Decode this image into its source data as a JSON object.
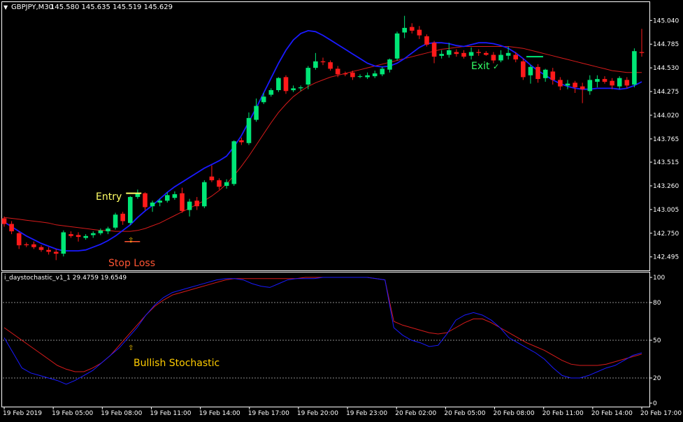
{
  "header": {
    "symbol_label": "GBPJPY,M30",
    "ohlc": "145.580 145.635 145.519 145.629",
    "triangle_glyph": "▼"
  },
  "indicator": {
    "label": "i_daystochastic_v1_1 29.4759 19.6549"
  },
  "annotations": {
    "entry": "Entry",
    "exit": "Exit",
    "exit_check": "✓",
    "stop_loss": "Stop Loss",
    "bullish": "Bullish Stochastic",
    "arrow_glyph": "⇧"
  },
  "colors": {
    "background": "#000000",
    "frame": "#ffffff",
    "bull": "#00e676",
    "bear": "#ff1a1a",
    "ma_fast": "#1a1aff",
    "ma_slow": "#d81b1b",
    "stoch_main": "#1a1aff",
    "stoch_signal": "#d81b1b",
    "entry_text": "#ffff66",
    "exit_text": "#33ff66",
    "stop_text": "#ff5533",
    "bullish_text": "#ffcc00",
    "entry_line": "#ffff66",
    "stop_line": "#ff5533",
    "exit_line": "#00e676"
  },
  "chart_data": [
    {
      "type": "candlestick",
      "series_type": "ohlc",
      "x_ticks": [
        "19 Feb 2019",
        "19 Feb 05:00",
        "19 Feb 08:00",
        "19 Feb 11:00",
        "19 Feb 14:00",
        "19 Feb 17:00",
        "19 Feb 20:00",
        "19 Feb 23:00",
        "20 Feb 02:00",
        "20 Feb 05:00",
        "20 Feb 08:00",
        "20 Feb 11:00",
        "20 Feb 14:00",
        "20 Feb 17:00"
      ],
      "y_ticks": [
        "145.040",
        "144.785",
        "144.530",
        "144.275",
        "144.020",
        "143.765",
        "143.515",
        "143.260",
        "143.005",
        "142.750",
        "142.495"
      ],
      "ylim": [
        142.44,
        145.11
      ],
      "candles": [
        [
          142.91,
          142.93,
          142.82,
          142.85
        ],
        [
          142.85,
          142.88,
          142.74,
          142.77
        ],
        [
          142.75,
          142.77,
          142.58,
          142.62
        ],
        [
          142.63,
          142.65,
          142.6,
          142.62
        ],
        [
          142.63,
          142.66,
          142.58,
          142.6
        ],
        [
          142.6,
          142.62,
          142.55,
          142.57
        ],
        [
          142.57,
          142.6,
          142.52,
          142.55
        ],
        [
          142.55,
          142.58,
          142.46,
          142.53
        ],
        [
          142.53,
          142.78,
          142.5,
          142.76
        ],
        [
          142.74,
          142.77,
          142.7,
          142.72
        ],
        [
          142.73,
          142.76,
          142.66,
          142.71
        ],
        [
          142.7,
          142.74,
          142.68,
          142.72
        ],
        [
          142.73,
          142.77,
          142.7,
          142.75
        ],
        [
          142.75,
          142.8,
          142.73,
          142.78
        ],
        [
          142.77,
          142.82,
          142.74,
          142.8
        ],
        [
          142.81,
          142.97,
          142.79,
          142.95
        ],
        [
          142.96,
          142.98,
          142.84,
          142.88
        ],
        [
          142.86,
          143.15,
          142.84,
          143.14
        ],
        [
          143.14,
          143.22,
          143.12,
          143.18
        ],
        [
          143.18,
          143.19,
          143.0,
          143.03
        ],
        [
          143.04,
          143.1,
          142.98,
          143.08
        ],
        [
          143.08,
          143.12,
          143.04,
          143.1
        ],
        [
          143.1,
          143.19,
          143.08,
          143.16
        ],
        [
          143.13,
          143.2,
          143.11,
          143.17
        ],
        [
          143.18,
          143.24,
          142.97,
          142.99
        ],
        [
          143.0,
          143.12,
          142.93,
          143.09
        ],
        [
          143.1,
          143.14,
          143.0,
          143.04
        ],
        [
          143.04,
          143.32,
          143.02,
          143.3
        ],
        [
          143.36,
          143.48,
          143.3,
          143.32
        ],
        [
          143.32,
          143.34,
          143.22,
          143.25
        ],
        [
          143.26,
          143.33,
          143.23,
          143.3
        ],
        [
          143.28,
          143.75,
          143.26,
          143.74
        ],
        [
          143.75,
          143.78,
          143.7,
          143.73
        ],
        [
          143.72,
          144.05,
          143.7,
          143.99
        ],
        [
          143.97,
          144.2,
          143.95,
          144.12
        ],
        [
          144.16,
          144.26,
          144.14,
          144.22
        ],
        [
          144.24,
          144.31,
          144.22,
          144.29
        ],
        [
          144.29,
          144.43,
          144.27,
          144.42
        ],
        [
          144.43,
          144.45,
          144.25,
          144.28
        ],
        [
          144.29,
          144.34,
          144.27,
          144.31
        ],
        [
          144.31,
          144.34,
          144.28,
          144.32
        ],
        [
          144.35,
          144.55,
          144.3,
          144.53
        ],
        [
          144.53,
          144.69,
          144.51,
          144.6
        ],
        [
          144.6,
          144.64,
          144.56,
          144.59
        ],
        [
          144.59,
          144.61,
          144.5,
          144.52
        ],
        [
          144.52,
          144.55,
          144.43,
          144.46
        ],
        [
          144.47,
          144.49,
          144.44,
          144.46
        ],
        [
          144.48,
          144.5,
          144.4,
          144.43
        ],
        [
          144.44,
          144.46,
          144.42,
          144.44
        ],
        [
          144.43,
          144.48,
          144.41,
          144.45
        ],
        [
          144.44,
          144.5,
          144.42,
          144.47
        ],
        [
          144.46,
          144.54,
          144.44,
          144.52
        ],
        [
          144.51,
          144.63,
          144.48,
          144.62
        ],
        [
          144.63,
          144.92,
          144.61,
          144.9
        ],
        [
          144.91,
          145.09,
          144.85,
          144.96
        ],
        [
          144.97,
          145.01,
          144.9,
          144.93
        ],
        [
          144.94,
          144.98,
          144.84,
          144.88
        ],
        [
          144.87,
          144.89,
          144.76,
          144.78
        ],
        [
          144.8,
          144.82,
          144.58,
          144.65
        ],
        [
          144.66,
          144.72,
          144.63,
          144.68
        ],
        [
          144.67,
          144.8,
          144.64,
          144.72
        ],
        [
          144.7,
          144.73,
          144.65,
          144.68
        ],
        [
          144.69,
          144.72,
          144.63,
          144.65
        ],
        [
          144.66,
          144.75,
          144.62,
          144.7
        ],
        [
          144.7,
          144.73,
          144.66,
          144.69
        ],
        [
          144.69,
          144.71,
          144.66,
          144.67
        ],
        [
          144.67,
          144.7,
          144.58,
          144.61
        ],
        [
          144.61,
          144.72,
          144.59,
          144.67
        ],
        [
          144.66,
          144.76,
          144.62,
          144.69
        ],
        [
          144.67,
          144.7,
          144.59,
          144.62
        ],
        [
          144.6,
          144.63,
          144.4,
          144.43
        ],
        [
          144.45,
          144.56,
          144.36,
          144.54
        ],
        [
          144.54,
          144.57,
          144.37,
          144.41
        ],
        [
          144.42,
          144.52,
          144.38,
          144.51
        ],
        [
          144.49,
          144.53,
          144.35,
          144.4
        ],
        [
          144.4,
          144.43,
          144.29,
          144.33
        ],
        [
          144.34,
          144.4,
          144.3,
          144.36
        ],
        [
          144.37,
          144.39,
          144.26,
          144.32
        ],
        [
          144.33,
          144.37,
          144.15,
          144.3
        ],
        [
          144.28,
          144.45,
          144.24,
          144.4
        ],
        [
          144.38,
          144.45,
          144.32,
          144.41
        ],
        [
          144.41,
          144.44,
          144.36,
          144.38
        ],
        [
          144.39,
          144.42,
          144.3,
          144.34
        ],
        [
          144.33,
          144.44,
          144.3,
          144.42
        ],
        [
          144.4,
          144.43,
          144.31,
          144.34
        ],
        [
          144.35,
          144.74,
          144.32,
          144.71
        ],
        [
          144.7,
          144.95,
          144.65,
          144.69
        ]
      ],
      "ma_fast": [
        142.87,
        142.82,
        142.77,
        142.72,
        142.68,
        142.64,
        142.61,
        142.58,
        142.56,
        142.56,
        142.56,
        142.57,
        142.6,
        142.63,
        142.67,
        142.72,
        142.78,
        142.84,
        142.92,
        142.99,
        143.05,
        143.12,
        143.19,
        143.25,
        143.3,
        143.35,
        143.4,
        143.45,
        143.49,
        143.53,
        143.58,
        143.68,
        143.8,
        143.95,
        144.1,
        144.26,
        144.42,
        144.58,
        144.72,
        144.83,
        144.9,
        144.93,
        144.92,
        144.88,
        144.83,
        144.78,
        144.73,
        144.68,
        144.63,
        144.58,
        144.55,
        144.54,
        144.55,
        144.58,
        144.63,
        144.69,
        144.75,
        144.79,
        144.8,
        144.8,
        144.79,
        144.77,
        144.76,
        144.78,
        144.8,
        144.8,
        144.79,
        144.77,
        144.74,
        144.69,
        144.63,
        144.56,
        144.5,
        144.45,
        144.4,
        144.36,
        144.33,
        144.31,
        144.3,
        144.3,
        144.31,
        144.31,
        144.31,
        144.3,
        144.31,
        144.34,
        144.38
      ],
      "ma_slow": [
        142.92,
        142.91,
        142.9,
        142.89,
        142.88,
        142.87,
        142.86,
        142.84,
        142.83,
        142.82,
        142.81,
        142.8,
        142.79,
        142.78,
        142.78,
        142.77,
        142.77,
        142.77,
        142.78,
        142.8,
        142.83,
        142.86,
        142.9,
        142.94,
        142.98,
        143.02,
        143.06,
        143.1,
        143.15,
        143.21,
        143.28,
        143.37,
        143.47,
        143.58,
        143.7,
        143.82,
        143.94,
        144.05,
        144.14,
        144.22,
        144.28,
        144.33,
        144.37,
        144.4,
        144.43,
        144.45,
        144.47,
        144.49,
        144.51,
        144.53,
        144.55,
        144.57,
        144.59,
        144.61,
        144.63,
        144.65,
        144.67,
        144.69,
        144.71,
        144.73,
        144.74,
        144.75,
        144.76,
        144.76,
        144.76,
        144.76,
        144.76,
        144.76,
        144.76,
        144.75,
        144.74,
        144.72,
        144.7,
        144.68,
        144.66,
        144.64,
        144.62,
        144.6,
        144.58,
        144.56,
        144.54,
        144.52,
        144.5,
        144.49,
        144.48,
        144.48,
        144.48
      ],
      "entry_price": 143.18,
      "stop_price": 142.66,
      "exit_price": 144.65,
      "entry_index": 17,
      "exit_index": 71
    },
    {
      "type": "line",
      "ylim": [
        0,
        100
      ],
      "y_ticks": [
        0,
        20,
        50,
        80,
        100
      ],
      "levels": [
        20,
        50,
        80
      ],
      "stoch_main": [
        52,
        40,
        28,
        24,
        22,
        20,
        18,
        15,
        18,
        22,
        26,
        32,
        38,
        44,
        52,
        60,
        70,
        78,
        84,
        88,
        90,
        92,
        94,
        96,
        98,
        99,
        99,
        98,
        95,
        93,
        92,
        95,
        98,
        99,
        99,
        99,
        100,
        100,
        100,
        100,
        100,
        100,
        99,
        98,
        60,
        54,
        50,
        48,
        45,
        46,
        55,
        66,
        70,
        72,
        70,
        66,
        60,
        52,
        48,
        44,
        40,
        35,
        28,
        22,
        20,
        20,
        22,
        25,
        28,
        30,
        34,
        38,
        40
      ],
      "stoch_signal": [
        60,
        55,
        50,
        45,
        40,
        35,
        30,
        27,
        25,
        25,
        28,
        32,
        38,
        46,
        54,
        62,
        70,
        77,
        82,
        86,
        88,
        90,
        92,
        94,
        96,
        98,
        99,
        99,
        99,
        99,
        99,
        99,
        99,
        99,
        100,
        100,
        100,
        100,
        100,
        100,
        100,
        100,
        99,
        98,
        65,
        62,
        60,
        58,
        56,
        55,
        56,
        60,
        64,
        67,
        67,
        64,
        60,
        56,
        52,
        48,
        45,
        42,
        38,
        34,
        31,
        30,
        30,
        30,
        31,
        33,
        35,
        37,
        39
      ]
    }
  ]
}
